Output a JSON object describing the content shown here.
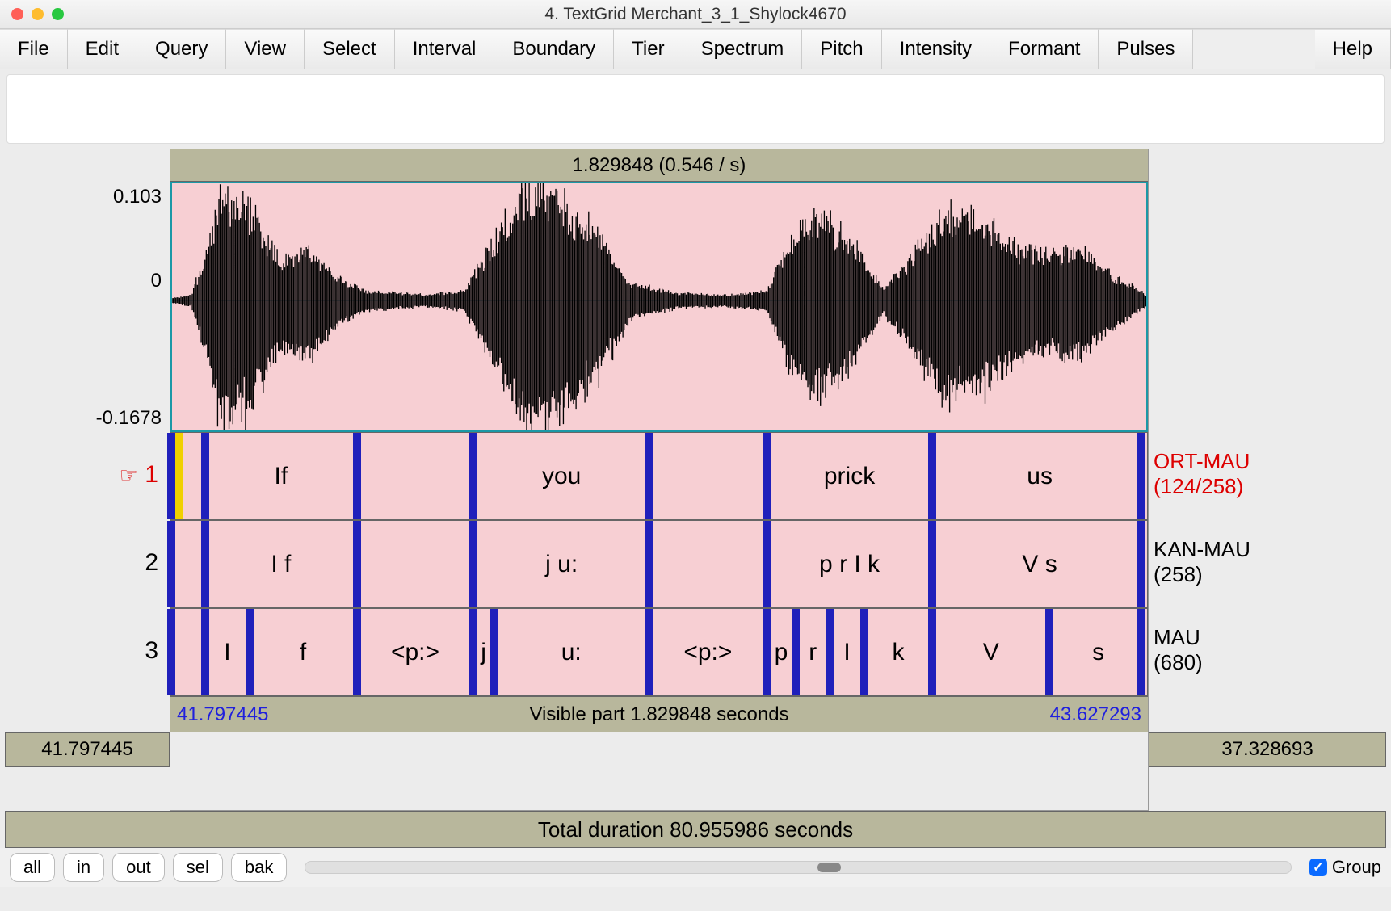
{
  "window": {
    "title": "4. TextGrid Merchant_3_1_Shylock4670"
  },
  "menu": {
    "items": [
      "File",
      "Edit",
      "Query",
      "View",
      "Select",
      "Interval",
      "Boundary",
      "Tier",
      "Spectrum",
      "Pitch",
      "Intensity",
      "Formant",
      "Pulses"
    ],
    "help": "Help"
  },
  "selection": {
    "summary": "1.829848 (0.546 / s)"
  },
  "waveform": {
    "ymax": "0.103",
    "yzero": "0",
    "ymin": "-0.1678"
  },
  "visible": {
    "start_label": "41.797445",
    "end_label": "43.627293",
    "text": "Visible part 1.829848 seconds"
  },
  "before": {
    "label": "41.797445"
  },
  "after": {
    "label": "37.328693"
  },
  "total": {
    "text": "Total duration 80.955986 seconds"
  },
  "tiers": [
    {
      "num": "1",
      "hand": "☞",
      "right_label_1": "ORT-MAU",
      "right_label_2": "(124/258)",
      "active": true,
      "segments": [
        {
          "label": "",
          "l": 0,
          "r": 3.5
        },
        {
          "label": "If",
          "l": 3.5,
          "r": 19
        },
        {
          "label": "",
          "l": 19,
          "r": 31
        },
        {
          "label": "you",
          "l": 31,
          "r": 49
        },
        {
          "label": "",
          "l": 49,
          "r": 61
        },
        {
          "label": "prick",
          "l": 61,
          "r": 78
        },
        {
          "label": "us",
          "l": 78,
          "r": 100
        }
      ],
      "boundaries": [
        0,
        3.5,
        19,
        31,
        49,
        61,
        78,
        99.3
      ]
    },
    {
      "num": "2",
      "right_label_1": "KAN-MAU",
      "right_label_2": "(258)",
      "segments": [
        {
          "label": "",
          "l": 0,
          "r": 3.5
        },
        {
          "label": "I f",
          "l": 3.5,
          "r": 19
        },
        {
          "label": "",
          "l": 19,
          "r": 31
        },
        {
          "label": "j u:",
          "l": 31,
          "r": 49
        },
        {
          "label": "",
          "l": 49,
          "r": 61
        },
        {
          "label": "p r I k",
          "l": 61,
          "r": 78
        },
        {
          "label": "V s",
          "l": 78,
          "r": 100
        }
      ],
      "boundaries": [
        0,
        3.5,
        19,
        31,
        49,
        61,
        78,
        99.3
      ]
    },
    {
      "num": "3",
      "right_label_1": "MAU",
      "right_label_2": "(680)",
      "segments": [
        {
          "label": "",
          "l": 0,
          "r": 3.5
        },
        {
          "label": "I",
          "l": 3.5,
          "r": 8
        },
        {
          "label": "f",
          "l": 8,
          "r": 19
        },
        {
          "label": "<p:>",
          "l": 19,
          "r": 31
        },
        {
          "label": "j",
          "l": 31,
          "r": 33
        },
        {
          "label": "u:",
          "l": 33,
          "r": 49
        },
        {
          "label": "<p:>",
          "l": 49,
          "r": 61
        },
        {
          "label": "p",
          "l": 61,
          "r": 64
        },
        {
          "label": "r",
          "l": 64,
          "r": 67.5
        },
        {
          "label": "I",
          "l": 67.5,
          "r": 71
        },
        {
          "label": "k",
          "l": 71,
          "r": 78
        },
        {
          "label": "V",
          "l": 78,
          "r": 90
        },
        {
          "label": "s",
          "l": 90,
          "r": 100
        }
      ],
      "boundaries": [
        0,
        3.5,
        8,
        19,
        31,
        33,
        49,
        61,
        64,
        67.5,
        71,
        78,
        90,
        99.3
      ]
    }
  ],
  "bottom": {
    "buttons": [
      "all",
      "in",
      "out",
      "sel",
      "bak"
    ],
    "group_label": "Group",
    "group_checked": true,
    "scroll_thumb_left_pct": 52,
    "scroll_thumb_width_pct": 2.3
  }
}
